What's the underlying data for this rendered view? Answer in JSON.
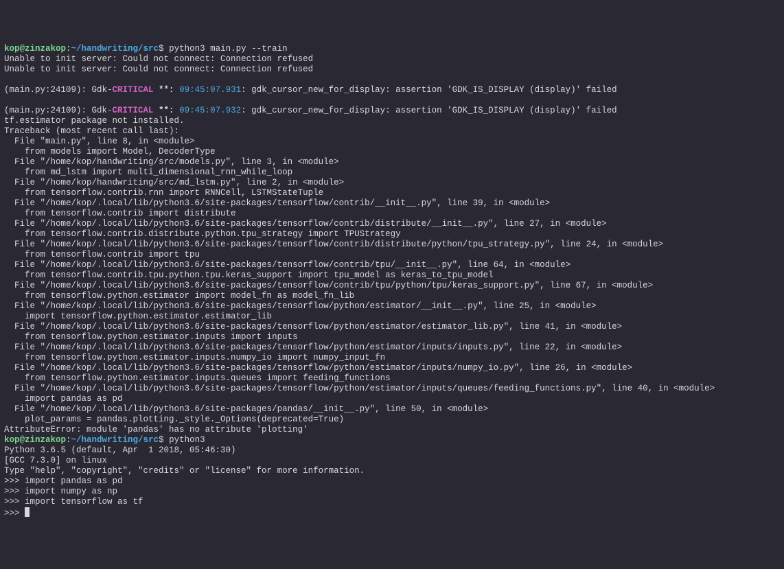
{
  "prompt1": {
    "user": "kop@zinzakop",
    "colon": ":",
    "path": "~/handwriting/src",
    "dollar": "$",
    "command": " python3 main.py --train"
  },
  "prompt2": {
    "user": "kop@zinzakop",
    "colon": ":",
    "path": "~/handwriting/src",
    "dollar": "$",
    "command": " python3"
  },
  "prompt3": ">>> ",
  "err_connect1": "Unable to init server: Could not connect: Connection refused",
  "err_connect2": "Unable to init server: Could not connect: Connection refused",
  "gdk1": {
    "prefix": "(main.py:24109): Gdk-",
    "critical": "CRITICAL",
    "stars": " **: ",
    "time": "09:45:07.931",
    "rest": ": gdk_cursor_new_for_display: assertion 'GDK_IS_DISPLAY (display)' failed"
  },
  "gdk2": {
    "prefix": "(main.py:24109): Gdk-",
    "critical": "CRITICAL",
    "stars": " **: ",
    "time": "09:45:07.932",
    "rest": ": gdk_cursor_new_for_display: assertion 'GDK_IS_DISPLAY (display)' failed"
  },
  "tf_est": "tf.estimator package not installed.",
  "tb_head": "Traceback (most recent call last):",
  "tb": [
    "  File \"main.py\", line 8, in <module>",
    "    from models import Model, DecoderType",
    "  File \"/home/kop/handwriting/src/models.py\", line 3, in <module>",
    "    from md_lstm import multi_dimensional_rnn_while_loop",
    "  File \"/home/kop/handwriting/src/md_lstm.py\", line 2, in <module>",
    "    from tensorflow.contrib.rnn import RNNCell, LSTMStateTuple",
    "  File \"/home/kop/.local/lib/python3.6/site-packages/tensorflow/contrib/__init__.py\", line 39, in <module>",
    "    from tensorflow.contrib import distribute",
    "  File \"/home/kop/.local/lib/python3.6/site-packages/tensorflow/contrib/distribute/__init__.py\", line 27, in <module>",
    "    from tensorflow.contrib.distribute.python.tpu_strategy import TPUStrategy",
    "  File \"/home/kop/.local/lib/python3.6/site-packages/tensorflow/contrib/distribute/python/tpu_strategy.py\", line 24, in <module>",
    "    from tensorflow.contrib import tpu",
    "  File \"/home/kop/.local/lib/python3.6/site-packages/tensorflow/contrib/tpu/__init__.py\", line 64, in <module>",
    "    from tensorflow.contrib.tpu.python.tpu.keras_support import tpu_model as keras_to_tpu_model",
    "  File \"/home/kop/.local/lib/python3.6/site-packages/tensorflow/contrib/tpu/python/tpu/keras_support.py\", line 67, in <module>",
    "    from tensorflow.python.estimator import model_fn as model_fn_lib",
    "  File \"/home/kop/.local/lib/python3.6/site-packages/tensorflow/python/estimator/__init__.py\", line 25, in <module>",
    "    import tensorflow.python.estimator.estimator_lib",
    "  File \"/home/kop/.local/lib/python3.6/site-packages/tensorflow/python/estimator/estimator_lib.py\", line 41, in <module>",
    "    from tensorflow.python.estimator.inputs import inputs",
    "  File \"/home/kop/.local/lib/python3.6/site-packages/tensorflow/python/estimator/inputs/inputs.py\", line 22, in <module>",
    "    from tensorflow.python.estimator.inputs.numpy_io import numpy_input_fn",
    "  File \"/home/kop/.local/lib/python3.6/site-packages/tensorflow/python/estimator/inputs/numpy_io.py\", line 26, in <module>",
    "    from tensorflow.python.estimator.inputs.queues import feeding_functions",
    "  File \"/home/kop/.local/lib/python3.6/site-packages/tensorflow/python/estimator/inputs/queues/feeding_functions.py\", line 40, in <module>",
    "    import pandas as pd",
    "  File \"/home/kop/.local/lib/python3.6/site-packages/pandas/__init__.py\", line 50, in <module>",
    "    plot_params = pandas.plotting._style._Options(deprecated=True)"
  ],
  "tb_err": "AttributeError: module 'pandas' has no attribute 'plotting'",
  "py_banner": [
    "Python 3.6.5 (default, Apr  1 2018, 05:46:30)",
    "[GCC 7.3.0] on linux",
    "Type \"help\", \"copyright\", \"credits\" or \"license\" for more information."
  ],
  "repl": [
    ">>> import pandas as pd",
    ">>> import numpy as np",
    ">>> import tensorflow as tf"
  ]
}
